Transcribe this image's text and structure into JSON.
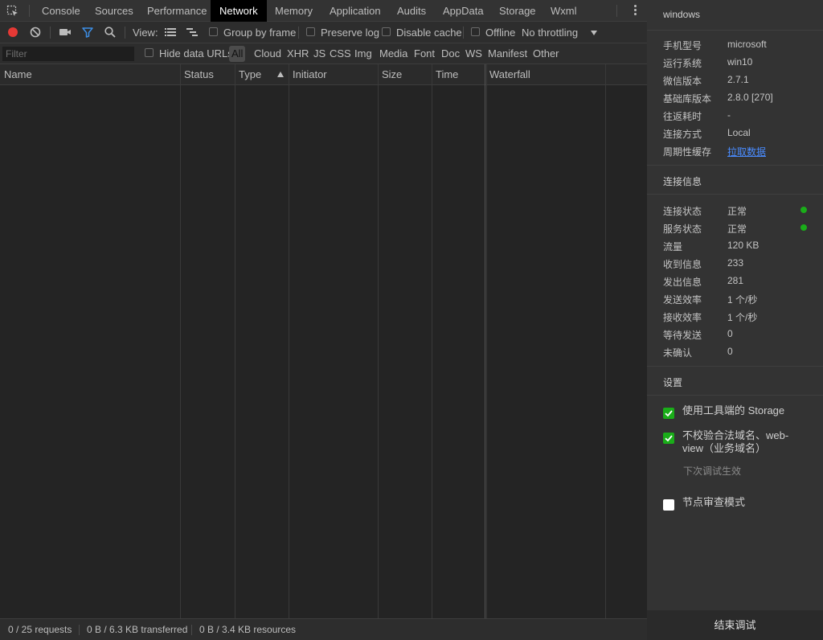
{
  "tabs": [
    "Console",
    "Sources",
    "Performance",
    "Network",
    "Memory",
    "Application",
    "Audits",
    "AppData",
    "Storage",
    "Wxml"
  ],
  "active_tab": "Network",
  "toolbar": {
    "view_label": "View:",
    "group_by_frame": "Group by frame",
    "preserve_log": "Preserve log",
    "disable_cache": "Disable cache",
    "offline": "Offline",
    "throttling": "No throttling"
  },
  "filterbar": {
    "placeholder": "Filter",
    "hide_data_urls": "Hide data URLs",
    "types": [
      "All",
      "Cloud",
      "XHR",
      "JS",
      "CSS",
      "Img",
      "Media",
      "Font",
      "Doc",
      "WS",
      "Manifest",
      "Other"
    ]
  },
  "columns": [
    "Name",
    "Status",
    "Type",
    "Initiator",
    "Size",
    "Time",
    "Waterfall"
  ],
  "status": {
    "requests": "0 / 25 requests",
    "transferred": "0 B / 6.3 KB transferred",
    "resources": "0 B / 3.4 KB resources"
  },
  "side": {
    "title": "windows",
    "device_info": [
      {
        "k": "手机型号",
        "v": "microsoft"
      },
      {
        "k": "运行系统",
        "v": "win10"
      },
      {
        "k": "微信版本",
        "v": "2.7.1"
      },
      {
        "k": "基础库版本",
        "v": "2.8.0 [270]"
      },
      {
        "k": "往返耗时",
        "v": "-"
      },
      {
        "k": "连接方式",
        "v": "Local"
      },
      {
        "k": "周期性缓存",
        "v": "拉取数据"
      }
    ],
    "conn_title": "连接信息",
    "conn_info": [
      {
        "k": "连接状态",
        "v": "正常"
      },
      {
        "k": "服务状态",
        "v": "正常"
      },
      {
        "k": "流量",
        "v": "120 KB"
      },
      {
        "k": "收到信息",
        "v": "233"
      },
      {
        "k": "发出信息",
        "v": "281"
      },
      {
        "k": "发送效率",
        "v": "1 个/秒"
      },
      {
        "k": "接收效率",
        "v": "1 个/秒"
      },
      {
        "k": "等待发送",
        "v": "0"
      },
      {
        "k": "未确认",
        "v": "0"
      }
    ],
    "settings_title": "设置",
    "settings": {
      "storage": "使用工具端的 Storage",
      "domain_line1": "不校验合法域名、web-",
      "domain_line2": "view（业务域名）",
      "domain_hint": "下次调试生效",
      "node_review": "节点审查模式"
    },
    "end_button": "结束调试"
  },
  "colors": {
    "status_ok": "#1aad19",
    "link": "#4a8cff",
    "record_red": "#e53935",
    "filter_blue": "#3d8ee5"
  }
}
